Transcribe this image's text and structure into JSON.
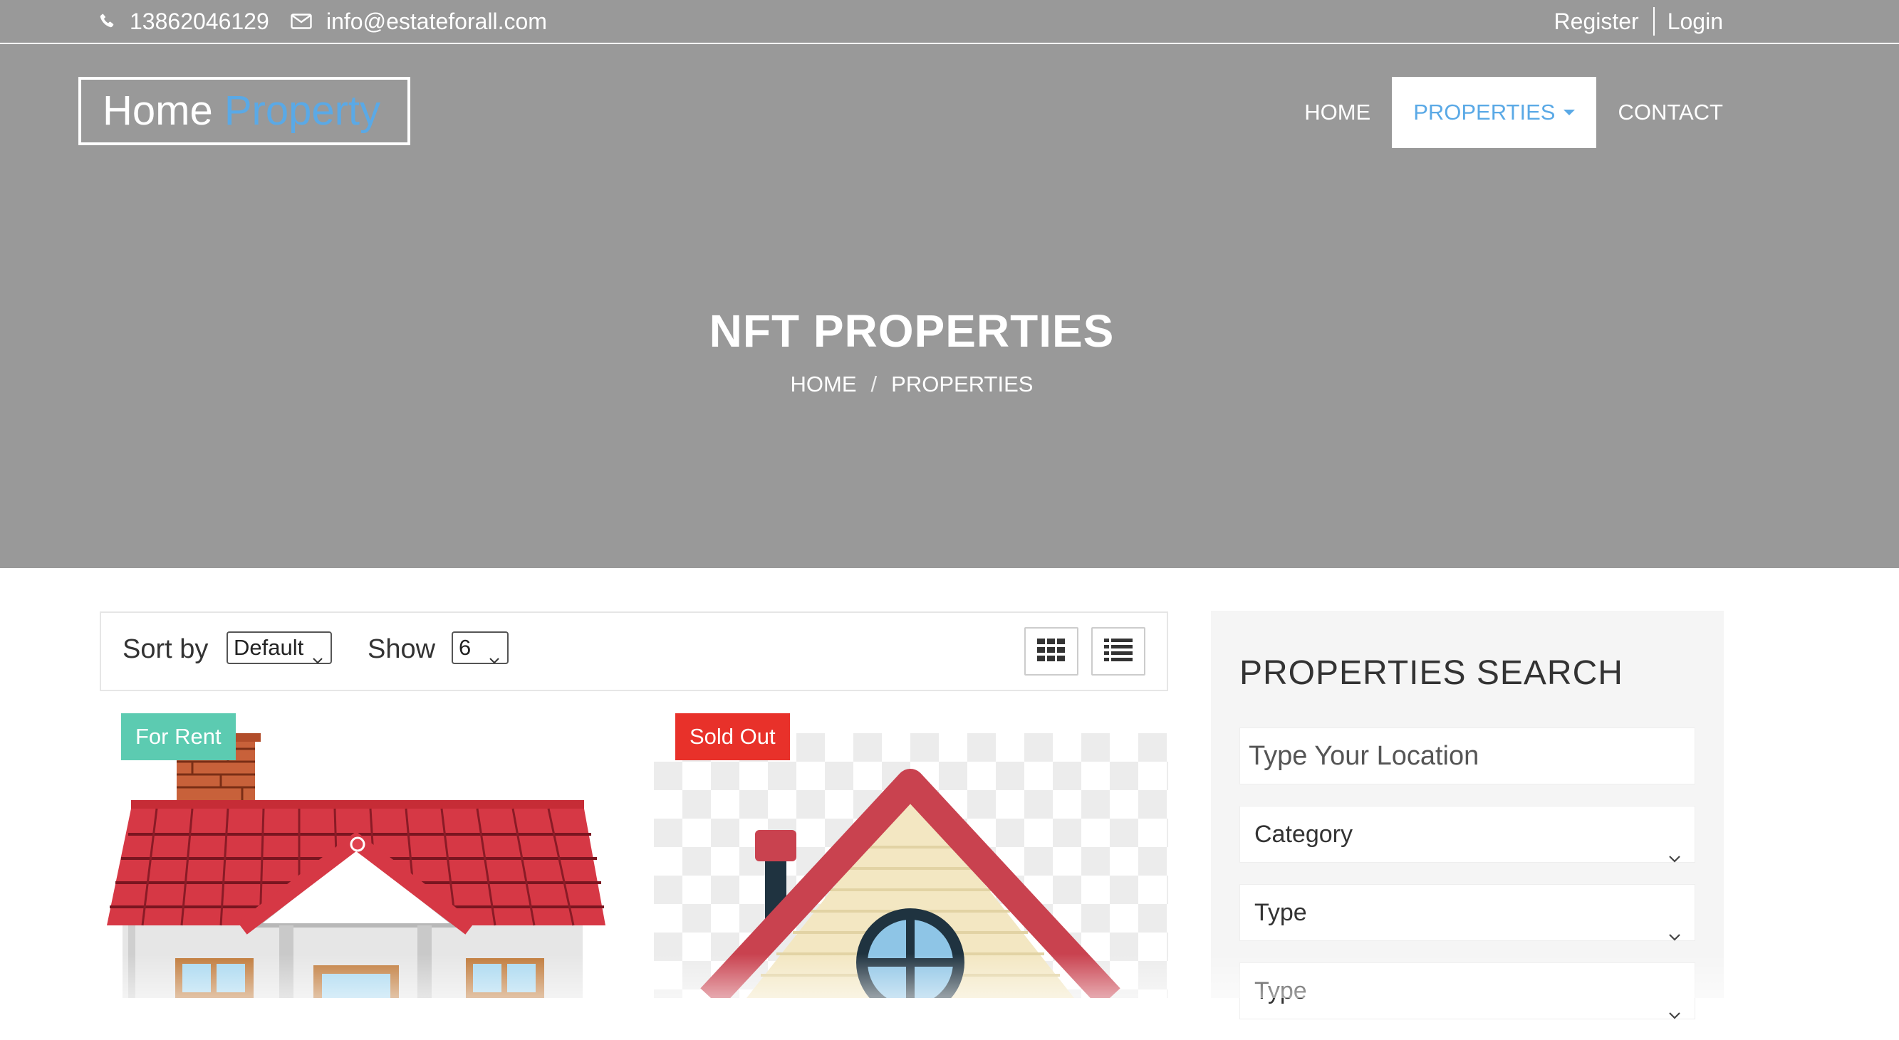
{
  "topbar": {
    "phone": "13862046129",
    "email": "info@estateforall.com",
    "register": "Register",
    "login": "Login"
  },
  "header": {
    "logo_part1": "Home",
    "logo_part2": "Property",
    "nav": {
      "home": "HOME",
      "properties": "PROPERTIES",
      "contact": "CONTACT"
    }
  },
  "hero": {
    "title": "NFT PROPERTIES",
    "breadcrumb": {
      "home": "HOME",
      "separator": "/",
      "current": "PROPERTIES"
    }
  },
  "toolbar": {
    "sort_label": "Sort by",
    "sort_value": "Default",
    "show_label": "Show",
    "show_value": "6"
  },
  "listings": [
    {
      "badge": "For Rent"
    },
    {
      "badge": "Sold Out"
    }
  ],
  "search": {
    "title": "PROPERTIES SEARCH",
    "location_placeholder": "Type Your Location",
    "category": "Category",
    "type": "Type",
    "type2": "Type"
  },
  "colors": {
    "header_bg": "#999999",
    "accent": "#5aa9e6",
    "for_rent": "#5ccbb1",
    "sold_out": "#e8312a"
  }
}
